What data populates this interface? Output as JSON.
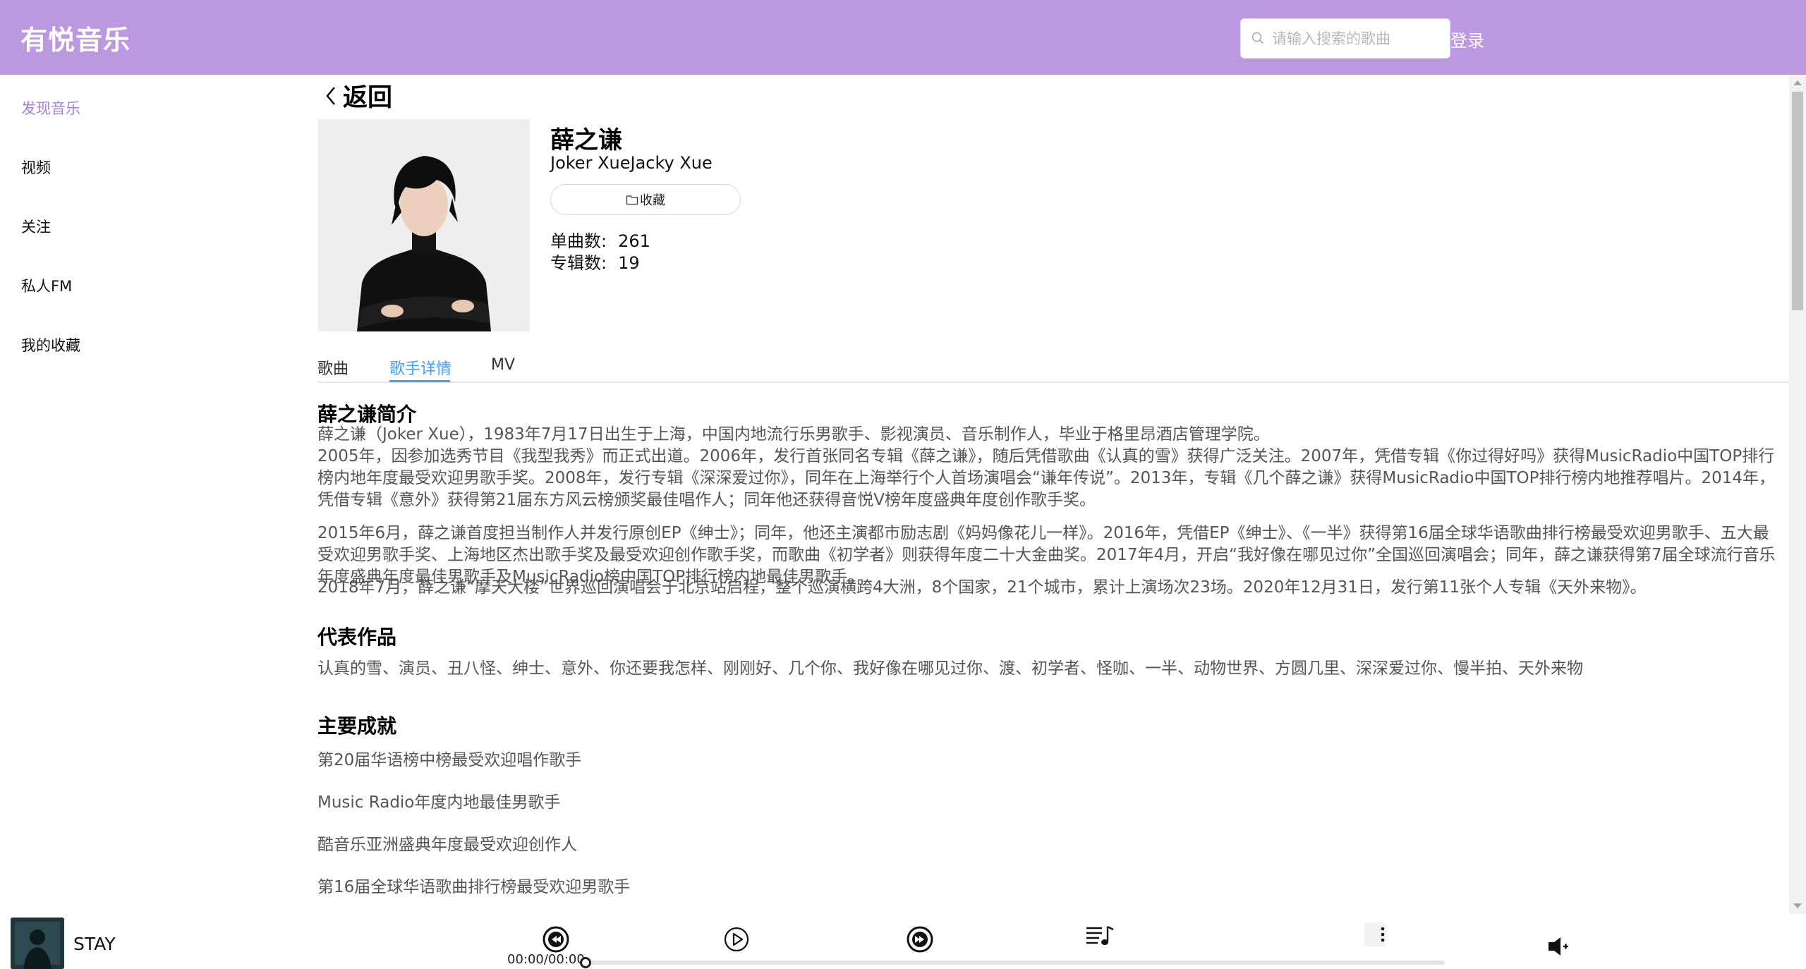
{
  "header": {
    "logo": "有悦音乐",
    "search_placeholder": "请输入搜索的歌曲",
    "login": "登录"
  },
  "sidebar": {
    "items": [
      {
        "label": "发现音乐",
        "active": true
      },
      {
        "label": "视频",
        "active": false
      },
      {
        "label": "关注",
        "active": false
      },
      {
        "label": "私人FM",
        "active": false
      },
      {
        "label": "我的收藏",
        "active": false
      }
    ]
  },
  "main": {
    "back_label": "返回",
    "artist": {
      "name": "薛之谦",
      "alias": "Joker XueJacky Xue",
      "fav_label": "收藏",
      "songs_label": "单曲数:",
      "songs_count": "261",
      "albums_label": "专辑数:",
      "albums_count": "19"
    },
    "tabs": [
      "歌曲",
      "歌手详情",
      "MV"
    ],
    "active_tab": "歌手详情",
    "intro_title": "薛之谦简介",
    "intro_paragraphs": [
      "薛之谦（Joker Xue），1983年7月17日出生于上海，中国内地流行乐男歌手、影视演员、音乐制作人，毕业于格里昂酒店管理学院。",
      "2005年，因参加选秀节目《我型我秀》而正式出道。2006年，发行首张同名专辑《薛之谦》，随后凭借歌曲《认真的雪》获得广泛关注。2007年，凭借专辑《你过得好吗》获得MusicRadio中国TOP排行榜内地年度最受欢迎男歌手奖。2008年，发行专辑《深深爱过你》，同年在上海举行个人首场演唱会“谦年传说”。2013年，专辑《几个薛之谦》获得MusicRadio中国TOP排行榜内地推荐唱片。2014年，凭借专辑《意外》获得第21届东方风云榜颁奖最佳唱作人；同年他还获得音悦V榜年度盛典年度创作歌手奖。",
      "2015年6月，薛之谦首度担当制作人并发行原创EP《绅士》；同年，他还主演都市励志剧《妈妈像花儿一样》。2016年，凭借EP《绅士》、《一半》获得第16届全球华语歌曲排行榜最受欢迎男歌手、五大最受欢迎男歌手奖、上海地区杰出歌手奖及最受欢迎创作歌手奖，而歌曲《初学者》则获得年度二十大金曲奖。2017年4月，开启“我好像在哪见过你”全国巡回演唱会；同年，薛之谦获得第7届全球流行音乐年度盛典年度最佳男歌手及MusicRadio榜中国TOP排行榜内地最佳男歌手。",
      "2018年7月，薛之谦“摩天大楼”世界巡回演唱会于北京站启程，整个巡演横跨4大洲，8个国家，21个城市，累计上演场次23场。2020年12月31日，发行第11张个人专辑《天外来物》。"
    ],
    "works_title": "代表作品",
    "works": "认真的雪、演员、丑八怪、绅士、意外、你还要我怎样、刚刚好、几个你、我好像在哪见过你、渡、初学者、怪咖、一半、动物世界、方圆几里、深深爱过你、慢半拍、天外来物",
    "achievements_title": "主要成就",
    "achievements": [
      "第20届华语榜中榜最受欢迎唱作歌手",
      "Music Radio年度内地最佳男歌手",
      "酷音乐亚洲盛典年度最受欢迎创作人",
      "第16届全球华语歌曲排行榜最受欢迎男歌手"
    ]
  },
  "player": {
    "song": "STAY",
    "time": "00:00/00:00",
    "progress": 0
  },
  "colors": {
    "header_bg": "#bc98e1",
    "sidebar_active": "#a57fd6",
    "tab_active": "#409eff"
  },
  "icons": [
    "search-icon",
    "chevron-left-icon",
    "folder-icon",
    "prev-icon",
    "play-icon",
    "next-icon",
    "playlist-icon",
    "more-icon",
    "volume-icon"
  ]
}
